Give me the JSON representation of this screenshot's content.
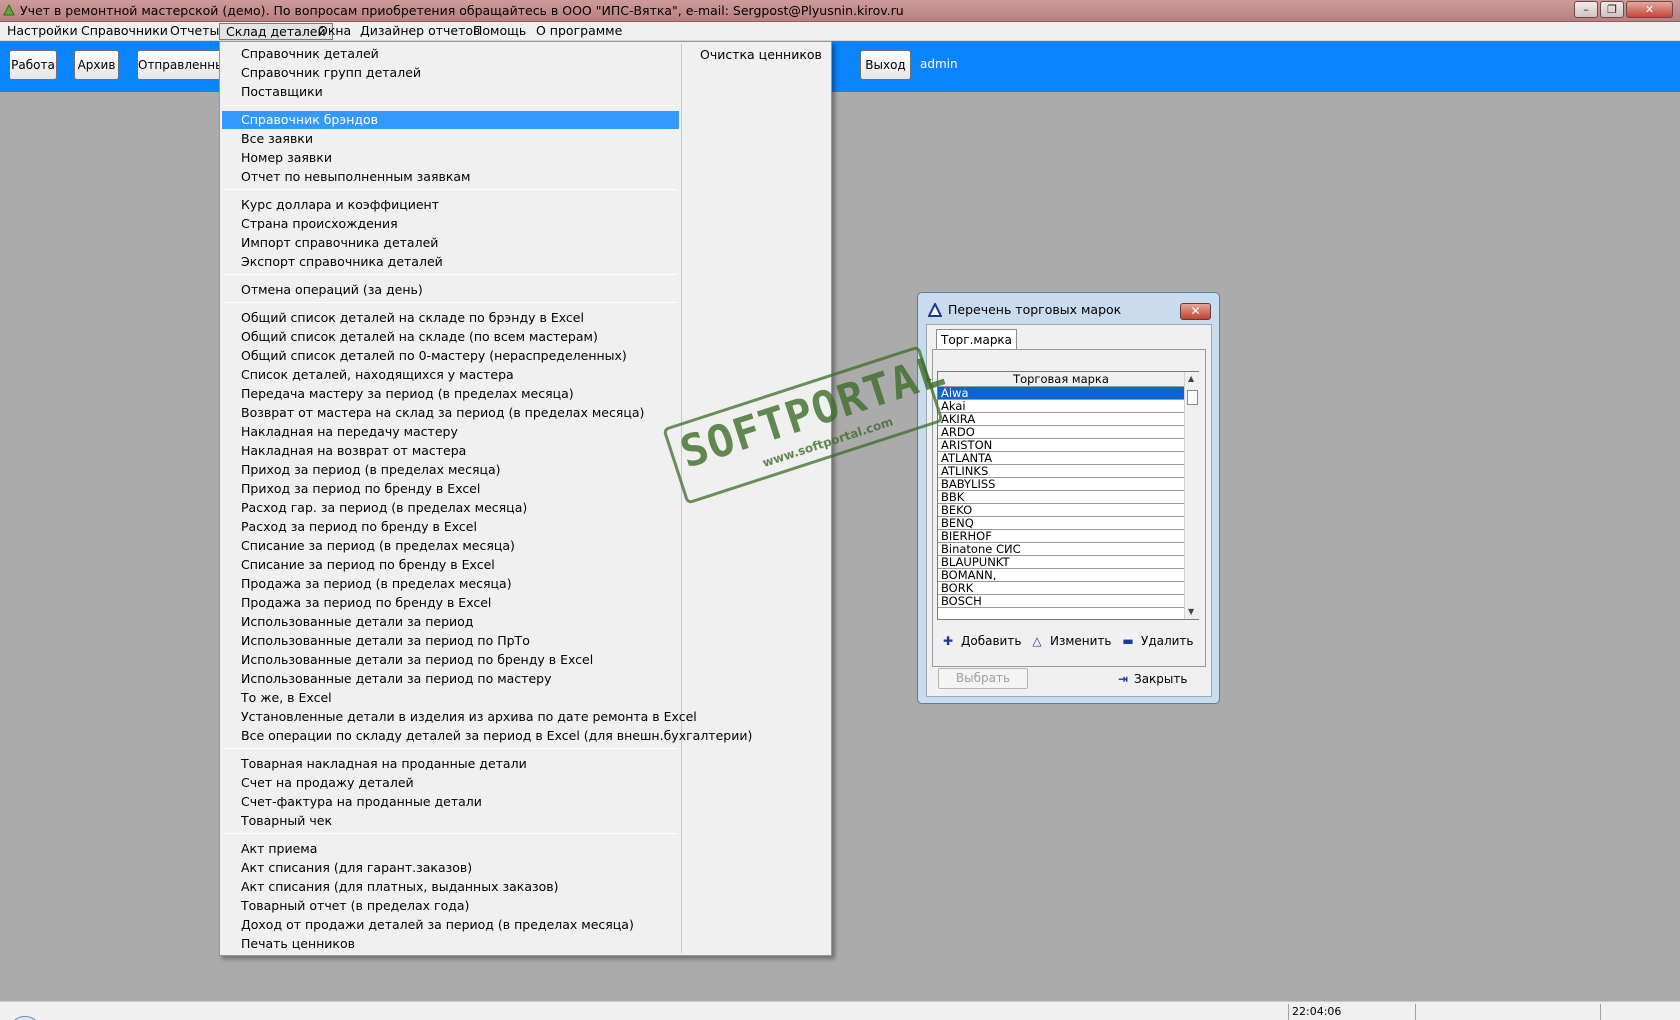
{
  "window": {
    "title": "Учет в ремонтной мастерской (демо). По вопросам приобретения обращайтесь в ООО \"ИПС-Вятка\", e-mail: Sergpost@Plyusnin.kirov.ru",
    "minimize": "–",
    "restore": "❐",
    "close": "✕"
  },
  "menubar": [
    "Настройки",
    "Справочники",
    "Отчеты",
    "Склад деталей",
    "Окна",
    "Дизайнер отчетов",
    "Помощь",
    "О программе"
  ],
  "toolbar": {
    "buttons": [
      "Работа",
      "Архив",
      "Отправленные",
      "Выход"
    ],
    "user": "admin"
  },
  "dropdown": {
    "items": [
      "Справочник деталей",
      "Справочник групп деталей",
      "Поставщики",
      "Справочник брэндов",
      "Все заявки",
      "Номер заявки",
      "Отчет по невыполненным заявкам",
      "Курс доллара и коэффициент",
      "Страна происхождения",
      "Импорт справочника деталей",
      "Экспорт справочника деталей",
      "Отмена операций (за день)",
      "Общий список деталей на складе по брэнду в Excel",
      "Общий список деталей на складе (по всем мастерам)",
      "Общий список деталей по 0-мастеру (нераспределенных)",
      "Список деталей, находящихся у мастера",
      "Передача мастеру за период (в пределах месяца)",
      "Возврат от мастера на склад за период (в пределах месяца)",
      "Накладная на передачу мастеру",
      "Накладная на возврат от мастера",
      "Приход за период (в пределах месяца)",
      "Приход за период по бренду в Excel",
      "Расход гар. за период (в пределах месяца)",
      "Расход за период по бренду в Excel",
      "Списание за период (в пределах месяца)",
      "Списание за период по бренду в Excel",
      "Продажа за период (в пределах месяца)",
      "Продажа за период по бренду в Excel",
      "Использованные детали за период",
      "Использованные детали за период по ПрТо",
      "Использованные детали за период по бренду в Excel",
      "Использованные детали за период по мастеру",
      "То же, в Excel",
      "Установленные детали в изделия из архива по дате ремонта в Excel",
      "Все операции по складу деталей за период в Excel (для внешн.бухгалтерии)",
      "Товарная накладная на проданные детали",
      "Счет на продажу деталей",
      "Счет-фактура на проданные детали",
      "Товарный чек",
      "Акт приема",
      "Акт списания (для гарант.заказов)",
      "Акт списания (для платных, выданных заказов)",
      "Товарный отчет (в пределах года)",
      "Доход от продажи деталей за период (в пределах месяца)",
      "Печать ценников"
    ],
    "right_items": [
      "Очистка ценников"
    ]
  },
  "watermark": {
    "big": "SOFTPORTAL",
    "small": "www.softportal.com"
  },
  "dialog": {
    "title": "Перечень торговых марок",
    "close": "✕",
    "tab": "Торг.марка",
    "column": "Торговая марка",
    "rows": [
      "Aiwa",
      "Akai",
      "AKIRA",
      "ARDO",
      "ARISTON",
      "ATLANTA",
      "ATLINKS",
      "BABYLISS",
      "BBK",
      "BEKO",
      "BENQ",
      "BIERHOF",
      "Binatone СИС",
      "BLAUPUNKT",
      "BOMANN,",
      "BORK",
      "BOSCH"
    ],
    "selected_row": "Aiwa",
    "actions": {
      "add": "Добавить",
      "edit": "Изменить",
      "delete": "Удалить"
    },
    "select_button": "Выбрать",
    "close_button": "Закрыть"
  },
  "statusbar": {
    "time": "22:04:06"
  },
  "colors": {
    "toolbar": "#0a84ff",
    "highlight": "#3399ff",
    "selected_row": "#0a64d8",
    "watermark": "#3c6e28"
  }
}
